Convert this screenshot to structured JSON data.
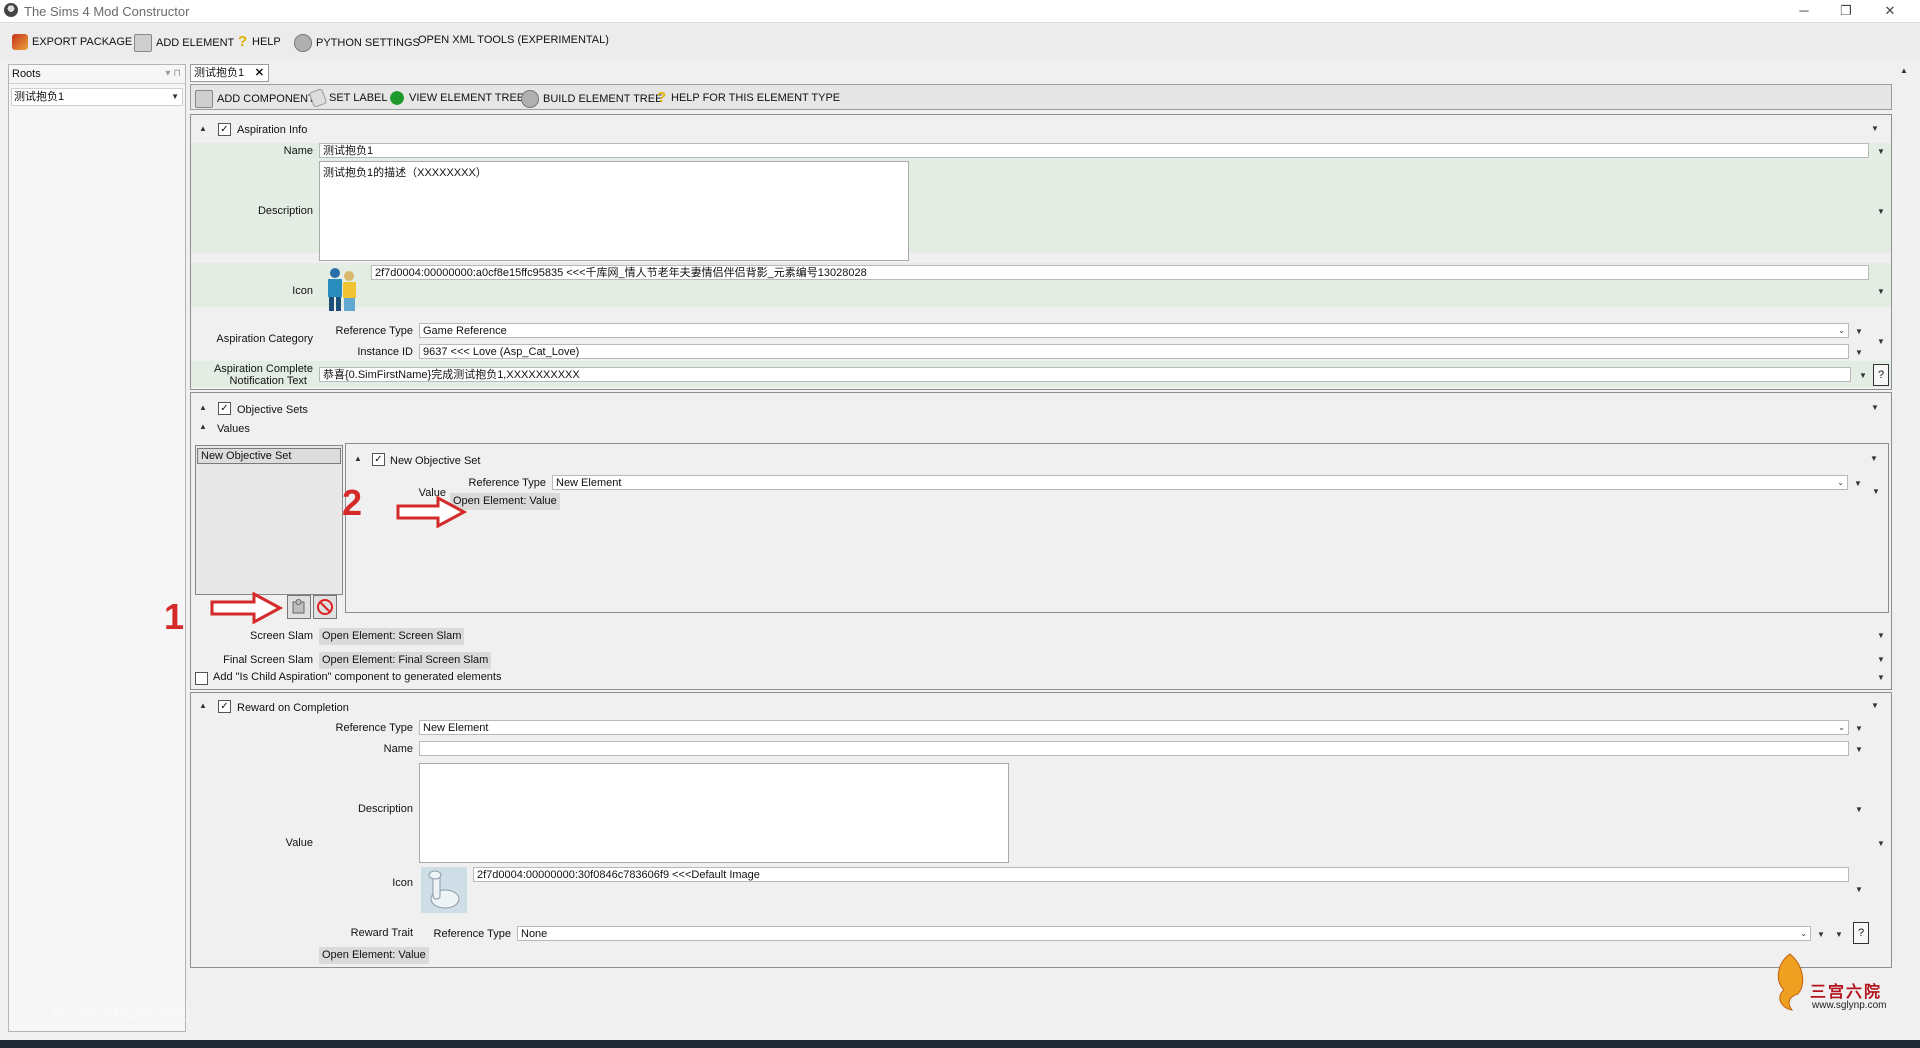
{
  "window": {
    "title": "The Sims 4 Mod Constructor",
    "minimize": "─",
    "maximize": "❐",
    "close": "✕"
  },
  "menu": {
    "export": "EXPORT PACKAGE",
    "add_element": "ADD ELEMENT",
    "help": "HELP",
    "python": "PYTHON SETTINGS",
    "xml": "OPEN XML TOOLS (EXPERIMENTAL)"
  },
  "sidebar": {
    "header": "Roots",
    "selected_root": "测试抱负1"
  },
  "doc_tab": {
    "label": "测试抱负1",
    "close": "✕"
  },
  "editor_toolbar": {
    "add_component": "ADD COMPONENT",
    "set_label": "SET LABEL",
    "view_tree": "VIEW ELEMENT TREE",
    "build_tree": "BUILD ELEMENT TREE",
    "help_type": "HELP FOR THIS ELEMENT TYPE"
  },
  "aspiration_info": {
    "title": "Aspiration Info",
    "name_label": "Name",
    "name_value": "测试抱负1",
    "description_label": "Description",
    "description_value": "测试抱负1的描述（XXXXXXXX）",
    "icon_label": "Icon",
    "icon_value": "2f7d0004:00000000:a0cf8e15ffc95835 <<<千库网_情人节老年夫妻情侣伴侣背影_元素编号13028028",
    "category_label": "Aspiration Category",
    "reference_type_label": "Reference Type",
    "reference_type_value": "Game Reference",
    "instance_id_label": "Instance ID",
    "instance_id_value": "9637 <<< Love (Asp_Cat_Love)",
    "notification_label_1": "Aspiration Complete",
    "notification_label_2": "Notification Text",
    "notification_value": "恭喜{0.SimFirstName}完成测试抱负1,XXXXXXXXXX",
    "help_q": "?"
  },
  "objective_sets": {
    "title": "Objective Sets",
    "values_label": "Values",
    "list_item": "New Objective Set",
    "inner_title": "New Objective Set",
    "inner_value_label": "Value",
    "inner_reference_type_label": "Reference Type",
    "inner_reference_type_value": "New Element",
    "open_value": "Open Element: Value",
    "screen_slam_label": "Screen Slam",
    "screen_slam_button": "Open Element: Screen Slam",
    "final_slam_label": "Final Screen Slam",
    "final_slam_button": "Open Element: Final Screen Slam",
    "child_aspiration": "Add \"Is Child Aspiration\" component to generated elements"
  },
  "annotations": {
    "one": "1",
    "two": "2"
  },
  "reward": {
    "title": "Reward on Completion",
    "reference_type_label": "Reference Type",
    "reference_type_value": "New Element",
    "name_label": "Name",
    "name_value": "",
    "description_label": "Description",
    "value_label": "Value",
    "icon_label": "Icon",
    "icon_value": "2f7d0004:00000000:30f0846c783606f9 <<<Default Image",
    "reward_trait_label": "Reward Trait",
    "trait_reference_type_label": "Reference Type",
    "trait_reference_type_value": "None",
    "open_value": "Open Element: Value",
    "help_q": "?"
  },
  "branding": {
    "watermark": "三宫六院-Ahrizoe原创",
    "logo_text": "三宫六院",
    "logo_url": "www.sglynp.com"
  },
  "colors": {
    "accent_red": "#d42a2a",
    "section_green": "#e3ede3",
    "panel_bg": "#f0f0f0"
  }
}
